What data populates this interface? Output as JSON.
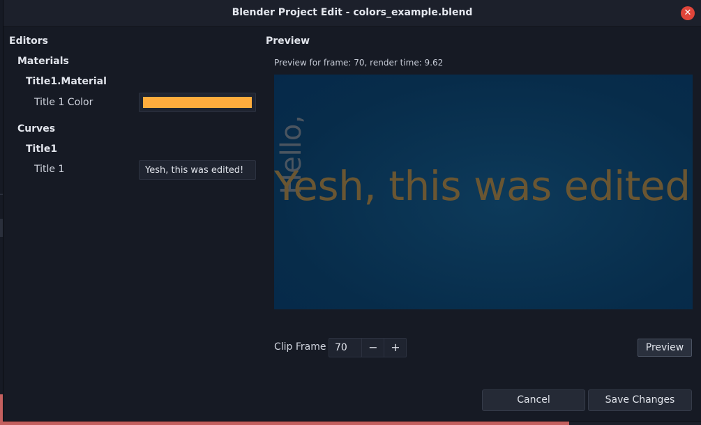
{
  "window": {
    "title": "Blender Project Edit - colors_example.blend",
    "close_glyph": "✕"
  },
  "editors": {
    "heading": "Editors",
    "materials": {
      "heading": "Materials",
      "group": "Title1.Material",
      "field_label": "Title 1 Color",
      "color_value": "#ffad3d"
    },
    "curves": {
      "heading": "Curves",
      "group": "Title1",
      "field_label": "Title 1",
      "text_value": "Yesh, this was edited!"
    }
  },
  "preview": {
    "heading": "Preview",
    "info": "Preview for frame: 70, render time: 9.62",
    "render_main_text": "Yesh, this was edited!",
    "render_vertical_text": "Hello,",
    "clip_frame_label": "Clip Frame",
    "clip_frame_value": "70",
    "decrement_glyph": "−",
    "increment_glyph": "+",
    "preview_button": "Preview"
  },
  "footer": {
    "cancel": "Cancel",
    "save": "Save Changes"
  },
  "colors": {
    "accent_orange": "#ffad3d",
    "close_red": "#e0453a",
    "background": "#161a24"
  }
}
